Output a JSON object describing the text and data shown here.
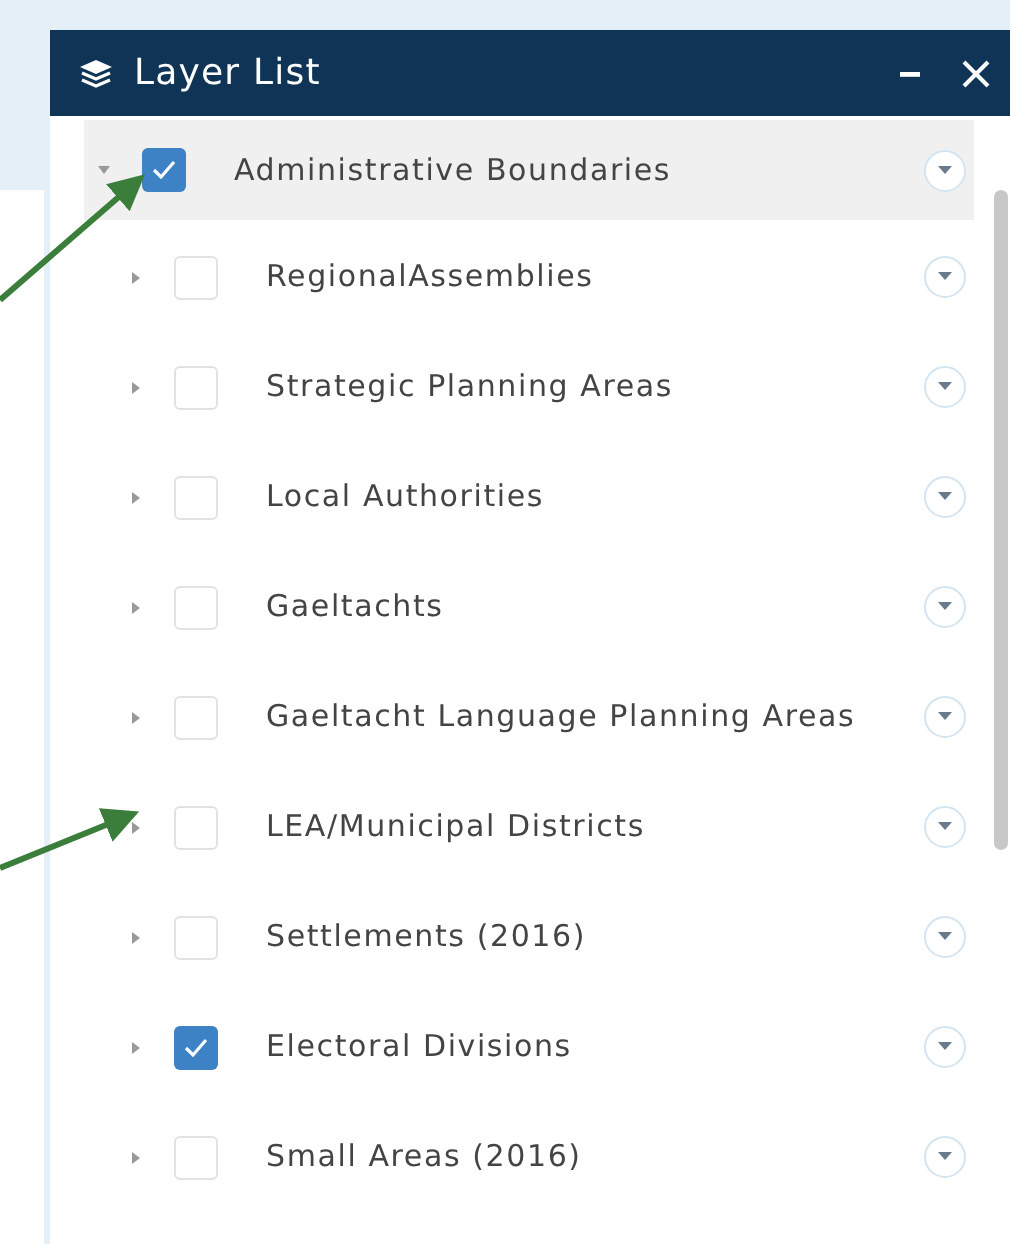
{
  "panel": {
    "title": "Layer List"
  },
  "layers": [
    {
      "name": "Administrative Boundaries",
      "checked": true,
      "expanded": true,
      "children": [
        {
          "name": "RegionalAssemblies",
          "checked": false,
          "expanded": false
        },
        {
          "name": "Strategic Planning Areas",
          "checked": false,
          "expanded": false
        },
        {
          "name": "Local Authorities",
          "checked": false,
          "expanded": false
        },
        {
          "name": "Gaeltachts",
          "checked": false,
          "expanded": false
        },
        {
          "name": "Gaeltacht Language Planning Areas",
          "checked": false,
          "expanded": false
        },
        {
          "name": "LEA/Municipal Districts",
          "checked": false,
          "expanded": false
        },
        {
          "name": "Settlements (2016)",
          "checked": false,
          "expanded": false
        },
        {
          "name": "Electoral Divisions",
          "checked": true,
          "expanded": false
        },
        {
          "name": "Small Areas (2016)",
          "checked": false,
          "expanded": false
        }
      ]
    }
  ]
}
